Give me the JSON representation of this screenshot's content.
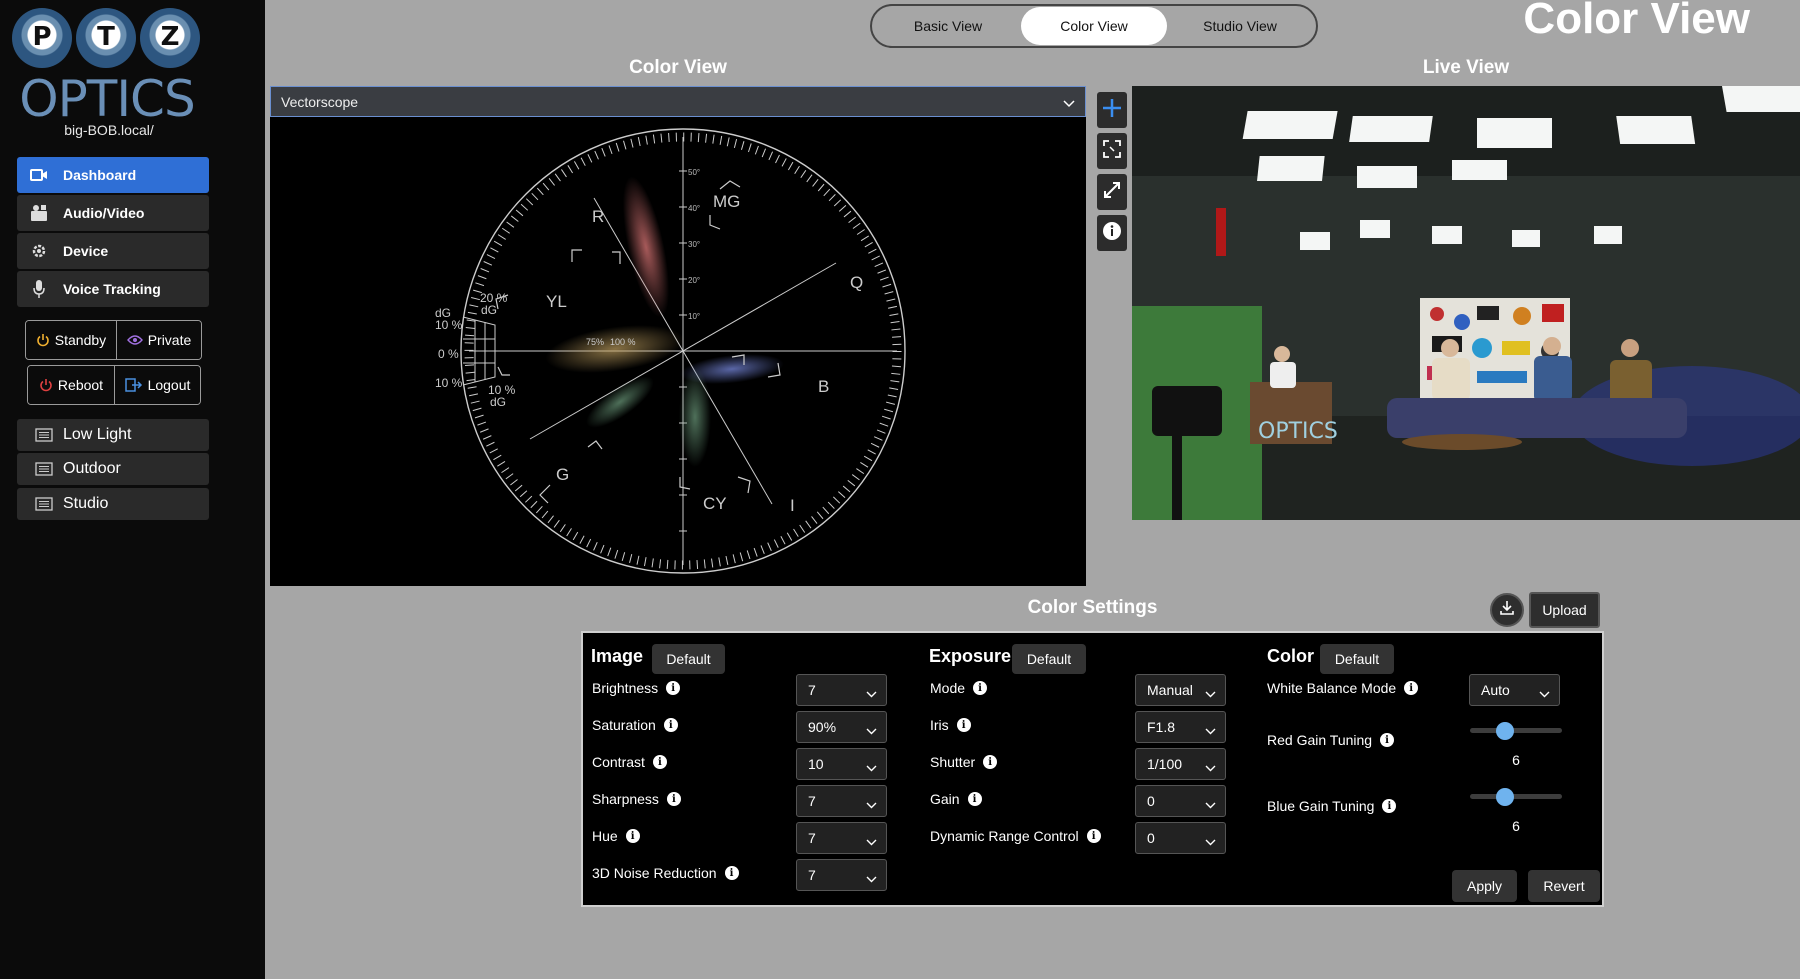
{
  "brand": {
    "letters": [
      "P",
      "T",
      "Z"
    ],
    "wordmark": "OPTICS",
    "hostname": "big-BOB.local/"
  },
  "sidebar": {
    "nav": [
      {
        "label": "Dashboard",
        "icon": "video-camera-icon",
        "active": true
      },
      {
        "label": "Audio/Video",
        "icon": "audio-video-icon",
        "active": false
      },
      {
        "label": "Device",
        "icon": "gear-icon",
        "active": false
      },
      {
        "label": "Voice Tracking",
        "icon": "microphone-icon",
        "active": false
      }
    ],
    "standby": "Standby",
    "private": "Private",
    "reboot": "Reboot",
    "logout": "Logout",
    "presets": [
      "Low Light",
      "Outdoor",
      "Studio"
    ]
  },
  "tabs": [
    "Basic View",
    "Color View",
    "Studio View"
  ],
  "active_tab": "Color View",
  "page_title": "Color View",
  "scope": {
    "title": "Color View",
    "mode": "Vectorscope",
    "targets": [
      "R",
      "MG",
      "B",
      "CY",
      "G",
      "YL"
    ],
    "axes": [
      "Q",
      "I"
    ],
    "ticks": [
      "50°",
      "40°",
      "30°",
      "20°",
      "10°"
    ],
    "left_labels": [
      "dG",
      "10 %",
      "0 %",
      "10 %"
    ],
    "gain_labels": {
      "upper": "20 %",
      "upper_sub": "dG",
      "lower": "10 %",
      "lower_sub": "dG"
    },
    "sat_labels": [
      "75%",
      "100 %"
    ]
  },
  "live": {
    "title": "Live View",
    "sign_text": "OPTICS"
  },
  "settings": {
    "title": "Color Settings",
    "upload": "Upload",
    "image": {
      "title": "Image",
      "default": "Default",
      "rows": [
        {
          "label": "Brightness",
          "value": "7"
        },
        {
          "label": "Saturation",
          "value": "90%"
        },
        {
          "label": "Contrast",
          "value": "10"
        },
        {
          "label": "Sharpness",
          "value": "7"
        },
        {
          "label": "Hue",
          "value": "7"
        },
        {
          "label": "3D Noise Reduction",
          "value": "7"
        }
      ]
    },
    "exposure": {
      "title": "Exposure",
      "default": "Default",
      "rows": [
        {
          "label": "Mode",
          "value": "Manual"
        },
        {
          "label": "Iris",
          "value": "F1.8"
        },
        {
          "label": "Shutter",
          "value": "1/100"
        },
        {
          "label": "Gain",
          "value": "0"
        },
        {
          "label": "Dynamic Range Control",
          "value": "0"
        }
      ]
    },
    "color": {
      "title": "Color",
      "default": "Default",
      "wb_label": "White Balance Mode",
      "wb_value": "Auto",
      "red_label": "Red Gain Tuning",
      "red_value": "6",
      "blue_label": "Blue Gain Tuning",
      "blue_value": "6",
      "slider_max": 20
    },
    "apply": "Apply",
    "revert": "Revert"
  }
}
